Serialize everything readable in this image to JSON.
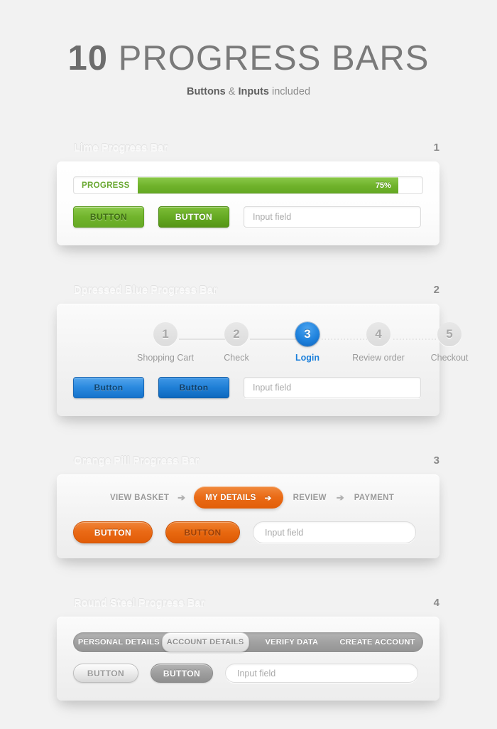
{
  "header": {
    "title_number": "10",
    "title_text": " PROGRESS BARS",
    "sub_a": "Buttons",
    "sub_b": " & ",
    "sub_c": "Inputs",
    "sub_d": " included"
  },
  "sections": [
    {
      "title": "Lime Progress Bar",
      "number": "1",
      "progress": {
        "label": "PROGRESS",
        "percent_label": "75%",
        "percent": 75
      },
      "buttons": [
        {
          "label": "BUTTON",
          "style": "btn-green-a"
        },
        {
          "label": "BUTTON",
          "style": "btn-green-b"
        }
      ],
      "input": {
        "placeholder": "Input field",
        "value": ""
      },
      "accent": "#6fb22b"
    },
    {
      "title": "Dpressed Blue Progress Bar",
      "number": "2",
      "steps": [
        {
          "num": "1",
          "label": "Shopping Cart",
          "active": false,
          "connector": "solid"
        },
        {
          "num": "2",
          "label": "Check",
          "active": false,
          "connector": "solid"
        },
        {
          "num": "3",
          "label": "Login",
          "active": true,
          "connector": "dotted"
        },
        {
          "num": "4",
          "label": "Review order",
          "active": false,
          "connector": "dotted"
        },
        {
          "num": "5",
          "label": "Checkout",
          "active": false,
          "connector": "none"
        }
      ],
      "buttons": [
        {
          "label": "Button",
          "style": "btn-blue-a"
        },
        {
          "label": "Button",
          "style": "btn-blue-b"
        }
      ],
      "input": {
        "placeholder": "Input field",
        "value": ""
      },
      "accent": "#1f82dd"
    },
    {
      "title": "Orange Pill Progress Bar",
      "number": "3",
      "pills": [
        {
          "label": "VIEW BASKET",
          "active": false
        },
        {
          "label": "MY DETAILS",
          "active": true
        },
        {
          "label": "REVIEW",
          "active": false
        },
        {
          "label": "PAYMENT",
          "active": false
        }
      ],
      "separator": "➔",
      "buttons": [
        {
          "label": "BUTTON",
          "style": "btn-orange-a"
        },
        {
          "label": "BUTTON",
          "style": "btn-orange-b"
        }
      ],
      "input": {
        "placeholder": "Input field",
        "value": ""
      },
      "accent": "#ea6b16"
    },
    {
      "title": "Round Steel Progress Bar",
      "number": "4",
      "segments": [
        {
          "label": "PERSONAL DETAILS",
          "active": false
        },
        {
          "label": "ACCOUNT DETAILS",
          "active": true
        },
        {
          "label": "VERIFY DATA",
          "active": false
        },
        {
          "label": "CREATE ACCOUNT",
          "active": false
        }
      ],
      "buttons": [
        {
          "label": "BUTTON",
          "style": "btn-steel-a"
        },
        {
          "label": "BUTTON",
          "style": "btn-steel-b"
        }
      ],
      "input": {
        "placeholder": "Input field",
        "value": ""
      },
      "accent": "#a2a2a2"
    }
  ]
}
